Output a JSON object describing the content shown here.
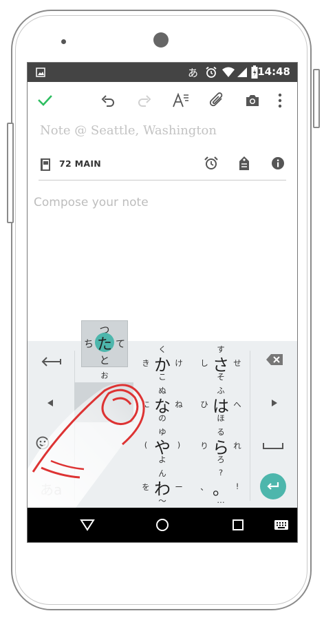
{
  "status": {
    "input_mode_glyph": "あ",
    "time": "14:48"
  },
  "toolbar": {
    "icons": [
      "check-icon",
      "undo-icon",
      "redo-icon",
      "text-format-icon",
      "attachment-icon",
      "camera-icon",
      "more-vert-icon"
    ]
  },
  "note": {
    "title_placeholder": "Note @ Seattle, Washington",
    "notebook": "72 MAIN",
    "body_placeholder": "Compose your note"
  },
  "keyboard": {
    "popup": {
      "center": "た",
      "up": "つ",
      "left": "ち",
      "right": "て",
      "down": "と"
    },
    "keys": {
      "ka": {
        "main": "か",
        "up": "く",
        "left": "き",
        "right": "け",
        "down": "こ"
      },
      "sa": {
        "main": "さ",
        "up": "す",
        "left": "し",
        "right": "せ",
        "down": "そ"
      },
      "na": {
        "main": "な",
        "up": "ぬ",
        "left": "に",
        "right": "ね",
        "down": "の"
      },
      "ha": {
        "main": "は",
        "up": "ふ",
        "left": "ひ",
        "right": "へ",
        "down": "ほ"
      },
      "ya": {
        "main": "や",
        "up": "ゆ",
        "left": "(",
        "right": ")",
        "down": "よ"
      },
      "ra": {
        "main": "ら",
        "up": "る",
        "left": "り",
        "right": "れ",
        "down": "ろ"
      },
      "wa": {
        "main": "わ",
        "up": "ん",
        "left": "を",
        "right": "ー",
        "down": "〜"
      },
      "punct": {
        "main": "。",
        "up": "?",
        "left": "、",
        "right": "!",
        "down": "…"
      },
      "a_small": "お"
    },
    "mode_label": "あa",
    "accent": "#4db6ac"
  },
  "navbar": {
    "icons": [
      "back-icon",
      "home-icon",
      "recents-icon",
      "keyboard-switch-icon"
    ]
  }
}
